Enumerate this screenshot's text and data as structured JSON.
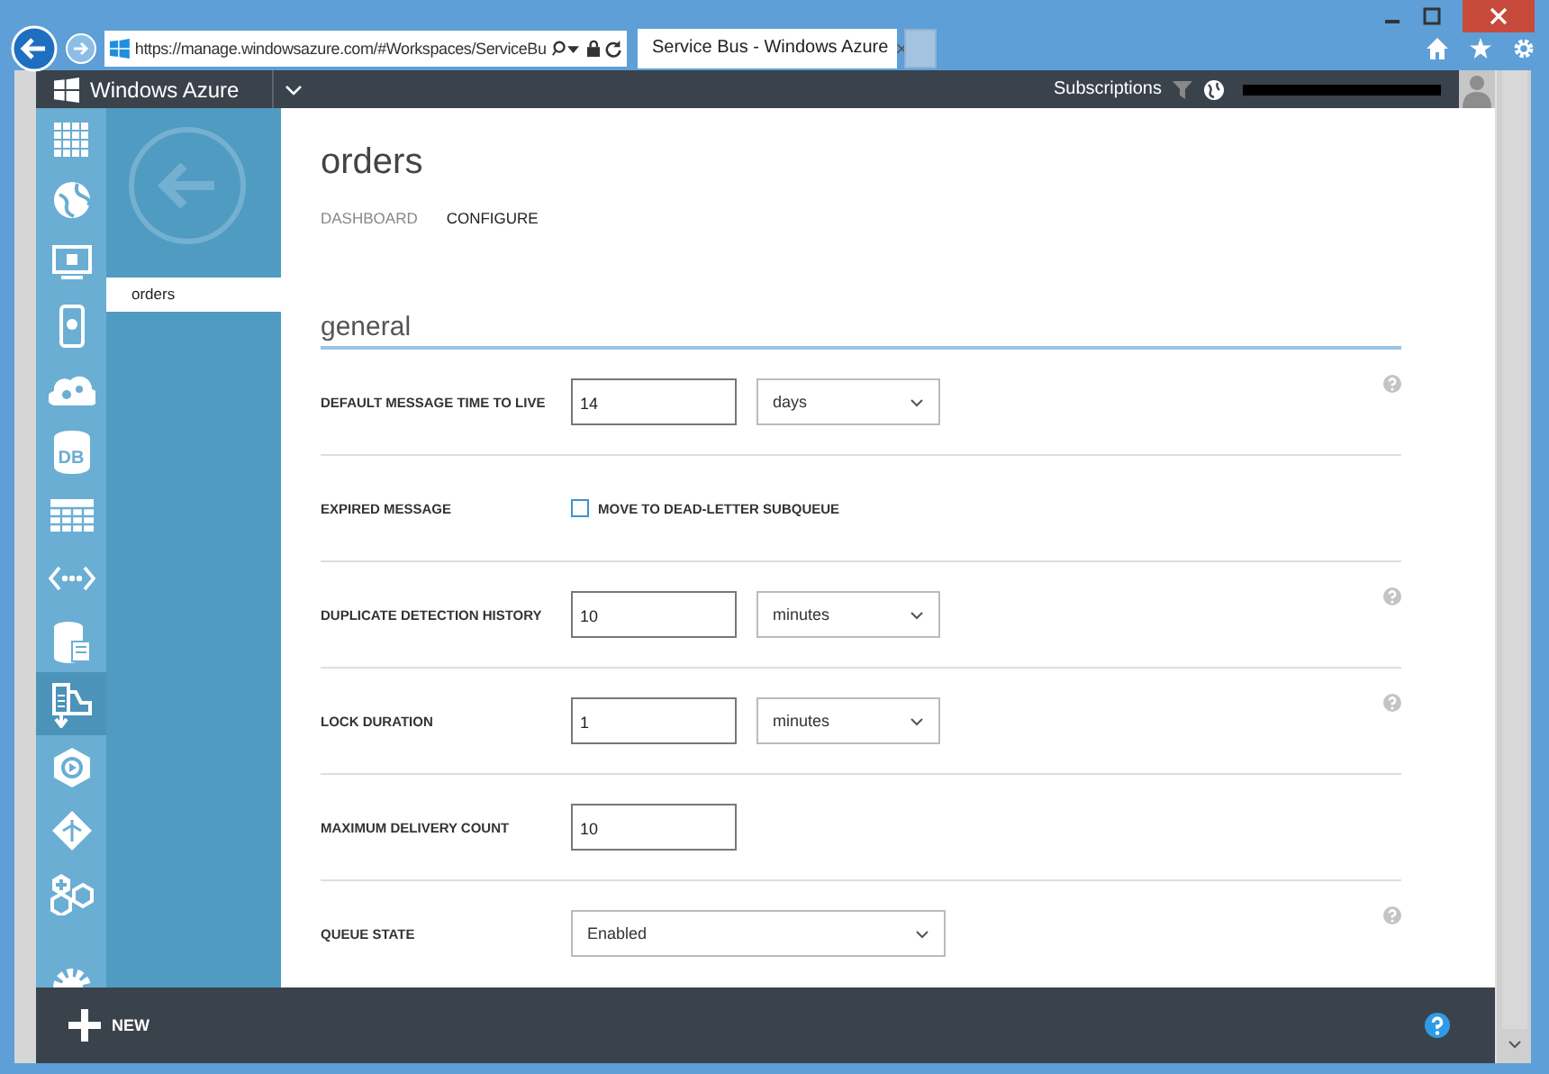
{
  "browser": {
    "address": "https://manage.windowsazure.com/#Workspaces/ServiceBu",
    "tab_title": "Service Bus - Windows Azure",
    "tab_close": "×"
  },
  "top_bar": {
    "brand": "Windows Azure",
    "subscriptions": "Subscriptions"
  },
  "nav_icons": [
    {
      "kind": "grid",
      "selected": false
    },
    {
      "kind": "globe",
      "selected": false
    },
    {
      "kind": "monitor",
      "selected": false
    },
    {
      "kind": "phone",
      "selected": false
    },
    {
      "kind": "cloud",
      "selected": false
    },
    {
      "kind": "db",
      "selected": false,
      "label": "DB"
    },
    {
      "kind": "table",
      "selected": false
    },
    {
      "kind": "code",
      "selected": false
    },
    {
      "kind": "storage",
      "selected": false
    },
    {
      "kind": "bus",
      "selected": true
    },
    {
      "kind": "media",
      "selected": false
    },
    {
      "kind": "diamond",
      "selected": false
    },
    {
      "kind": "hex",
      "selected": false
    },
    {
      "kind": "gear",
      "selected": false
    }
  ],
  "side_items": [
    {
      "label": "orders",
      "selected": true
    }
  ],
  "page": {
    "title": "orders",
    "tabs": [
      {
        "label": "DASHBOARD",
        "selected": false
      },
      {
        "label": "CONFIGURE",
        "selected": true
      }
    ],
    "section": "general"
  },
  "settings": [
    {
      "kind": "input_select",
      "label": "DEFAULT MESSAGE TIME TO LIVE",
      "value": "14",
      "unit": "days",
      "help": true
    },
    {
      "kind": "checkbox",
      "label": "EXPIRED MESSAGE",
      "option": "MOVE TO DEAD-LETTER SUBQUEUE",
      "checked": false,
      "help": false
    },
    {
      "kind": "input_select",
      "label": "DUPLICATE DETECTION HISTORY",
      "value": "10",
      "unit": "minutes",
      "help": true
    },
    {
      "kind": "input_select",
      "label": "LOCK DURATION",
      "value": "1",
      "unit": "minutes",
      "help": true
    },
    {
      "kind": "input",
      "label": "MAXIMUM DELIVERY COUNT",
      "value": "10",
      "help": false
    },
    {
      "kind": "select",
      "label": "QUEUE STATE",
      "unit": "Enabled",
      "help": true
    }
  ],
  "bottom_bar": {
    "new_label": "NEW"
  }
}
